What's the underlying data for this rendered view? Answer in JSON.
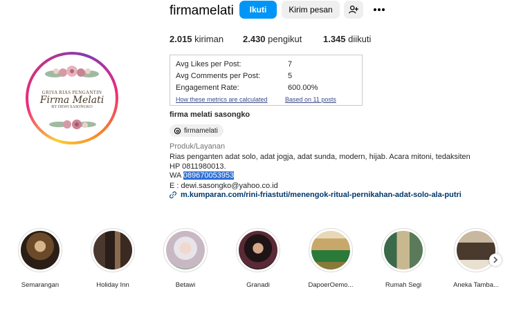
{
  "profile": {
    "username": "firmamelati",
    "follow_label": "Ikuti",
    "message_label": "Kirim pesan",
    "add_user_icon": "person-add-icon",
    "more_icon": "more-horizontal-icon",
    "avatar": {
      "line1": "GRIYA RIAS PENGANTIN",
      "line2": "Firma Melati",
      "line3": "BY DEWI SASONGKO"
    }
  },
  "stats": {
    "posts_count": "2.015",
    "posts_label": "kiriman",
    "followers_count": "2.430",
    "followers_label": "pengikut",
    "following_count": "1.345",
    "following_label": "diikuti"
  },
  "metrics": {
    "rows": [
      {
        "label": "Avg Likes per Post:",
        "value": "7"
      },
      {
        "label": "Avg Comments per Post:",
        "value": "5"
      },
      {
        "label": "Engagement Rate:",
        "value": "600.00%"
      }
    ],
    "calc_link": "How these metrics are calculated",
    "based_link": "Based on 11 posts"
  },
  "bio": {
    "full_name": "firma melati sasongko",
    "threads_handle": "firmamelati",
    "category": "Produk/Layanan",
    "line1": "Rias penganten adat solo, adat jogja, adat sunda, modern, hijab. Acara mitoni, tedaksiten",
    "line2": "HP 0811980013.",
    "wa_prefix": "WA ",
    "wa_number": "089670053953",
    "email": "E : dewi.sasongko@yahoo.co.id",
    "link": "m.kumparan.com/rini-friastuti/menengok-ritual-pernikahan-adat-solo-ala-putri"
  },
  "highlights": [
    {
      "label": "Semarangan",
      "color": "#6b4a2a"
    },
    {
      "label": "Holiday Inn",
      "color": "#3a2a22"
    },
    {
      "label": "Betawi",
      "color": "#c8b8c4"
    },
    {
      "label": "Granadi",
      "color": "#2a1a1e"
    },
    {
      "label": "DapoerOemo...",
      "color": "#8a7a3a"
    },
    {
      "label": "Rumah Segi",
      "color": "#5a7a5a"
    },
    {
      "label": "Aneka Tamba...",
      "color": "#4a3a2e"
    }
  ],
  "colors": {
    "accent": "#0095f6",
    "link": "#00376b",
    "selection": "#2f6fd6"
  }
}
